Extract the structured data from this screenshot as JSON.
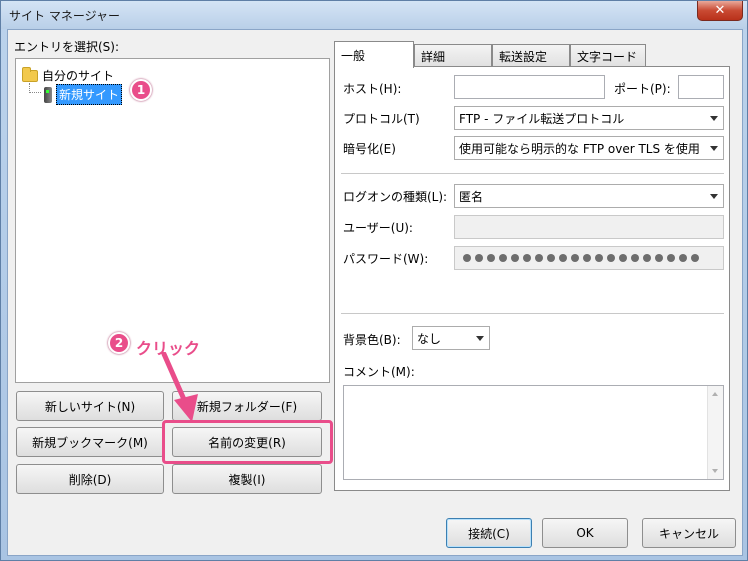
{
  "window": {
    "title": "サイト マネージャー",
    "close_symbol": "✕"
  },
  "left": {
    "select_label": "エントリを選択(S):",
    "tree": {
      "folder_label": "自分のサイト",
      "site_label": "新規サイト"
    },
    "buttons": {
      "new_site": "新しいサイト(N)",
      "new_folder": "新規フォルダー(F)",
      "new_bookmark": "新規ブックマーク(M)",
      "rename": "名前の変更(R)",
      "delete": "削除(D)",
      "copy": "複製(I)"
    }
  },
  "annotations": {
    "badge1": "1",
    "badge2": "2",
    "click_text": "クリック",
    "color": "#e94d8a"
  },
  "tabs": [
    {
      "label": "一般",
      "active": true
    },
    {
      "label": "詳細",
      "active": false
    },
    {
      "label": "転送設定",
      "active": false
    },
    {
      "label": "文字コード",
      "active": false
    }
  ],
  "general": {
    "host_label": "ホスト(H):",
    "host_value": "",
    "port_label": "ポート(P):",
    "port_value": "",
    "protocol_label": "プロトコル(T)",
    "protocol_value": "FTP - ファイル転送プロトコル",
    "encryption_label": "暗号化(E)",
    "encryption_value": "使用可能なら明示的な FTP over TLS を使用",
    "logon_type_label": "ログオンの種類(L):",
    "logon_type_value": "匿名",
    "user_label": "ユーザー(U):",
    "password_label": "パスワード(W):",
    "bg_color_label": "背景色(B):",
    "bg_color_value": "なし",
    "comment_label": "コメント(M):"
  },
  "footer": {
    "connect": "接続(C)",
    "ok": "OK",
    "cancel": "キャンセル"
  }
}
